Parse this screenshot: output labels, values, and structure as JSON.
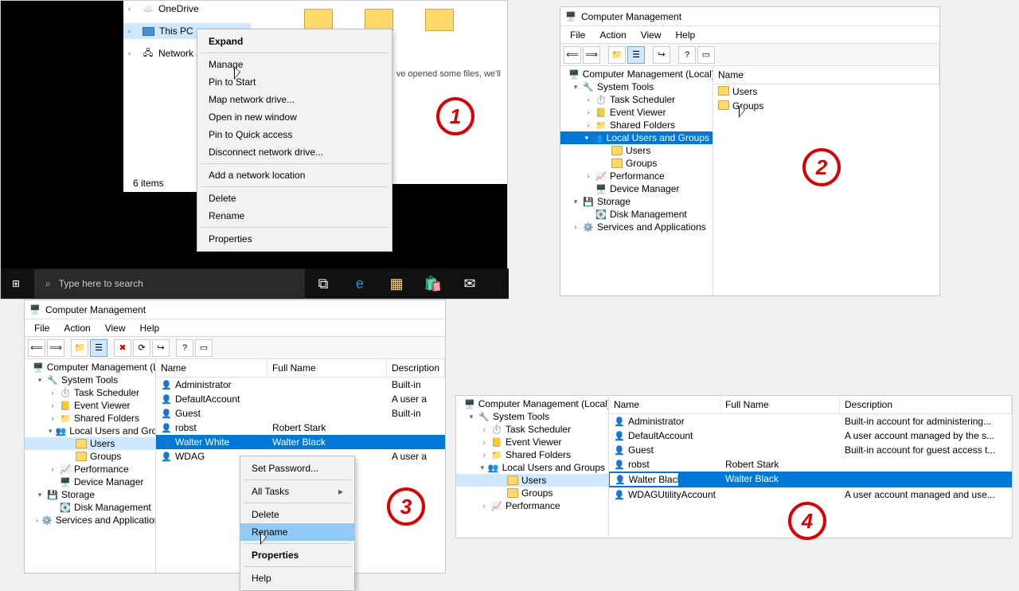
{
  "panel1": {
    "tree": {
      "onedrive": "OneDrive",
      "thispc": "This PC",
      "network": "Network"
    },
    "content_hint": "ve opened some files, we'll",
    "status": "6 items",
    "context_menu": {
      "expand": "Expand",
      "manage": "Manage",
      "pin_start": "Pin to Start",
      "map_drive": "Map network drive...",
      "open_new": "Open in new window",
      "pin_quick": "Pin to Quick access",
      "disconnect": "Disconnect network drive...",
      "add_loc": "Add a network location",
      "delete": "Delete",
      "rename": "Rename",
      "properties": "Properties"
    },
    "taskbar": {
      "search": "Type here to search"
    }
  },
  "cm_common": {
    "title": "Computer Management",
    "menu": {
      "file": "File",
      "action": "Action",
      "view": "View",
      "help": "Help"
    },
    "root": "Computer Management (Local)",
    "tree": {
      "system_tools": "System Tools",
      "task_scheduler": "Task Scheduler",
      "event_viewer": "Event Viewer",
      "shared_folders": "Shared Folders",
      "local_users": "Local Users and Groups",
      "users": "Users",
      "groups": "Groups",
      "performance": "Performance",
      "device_manager": "Device Manager",
      "storage": "Storage",
      "disk_management": "Disk Management",
      "services": "Services and Applications"
    }
  },
  "panel2": {
    "list_header": "Name",
    "items": {
      "users": "Users",
      "groups": "Groups"
    }
  },
  "panel3": {
    "headers": {
      "name": "Name",
      "fullname": "Full Name",
      "desc": "Description"
    },
    "rows": {
      "admin": {
        "name": "Administrator",
        "full": "",
        "desc": "Built-in"
      },
      "default": {
        "name": "DefaultAccount",
        "full": "",
        "desc": "A user a"
      },
      "guest": {
        "name": "Guest",
        "full": "",
        "desc": "Built-in"
      },
      "robst": {
        "name": "robst",
        "full": "Robert Stark",
        "desc": ""
      },
      "walter": {
        "name": "Walter White",
        "full": "Walter Black",
        "desc": ""
      },
      "wdag": {
        "name": "WDAG",
        "full": "",
        "desc": "A user a"
      }
    },
    "context_menu": {
      "set_password": "Set Password...",
      "all_tasks": "All Tasks",
      "delete": "Delete",
      "rename": "Rename",
      "properties": "Properties",
      "help": "Help"
    }
  },
  "panel4": {
    "headers": {
      "name": "Name",
      "fullname": "Full Name",
      "desc": "Description"
    },
    "rows": {
      "admin": {
        "name": "Administrator",
        "full": "",
        "desc": "Built-in account for administering..."
      },
      "default": {
        "name": "DefaultAccount",
        "full": "",
        "desc": "A user account managed by the s..."
      },
      "guest": {
        "name": "Guest",
        "full": "",
        "desc": "Built-in account for guest access t..."
      },
      "robst": {
        "name": "robst",
        "full": "Robert Stark",
        "desc": ""
      },
      "walter": {
        "name": "Walter Black",
        "full": "Walter Black",
        "desc": ""
      },
      "wdag": {
        "name": "WDAGUtilityAccount",
        "full": "",
        "desc": "A user account managed and use..."
      }
    }
  },
  "steps": {
    "s1": "1",
    "s2": "2",
    "s3": "3",
    "s4": "4"
  }
}
